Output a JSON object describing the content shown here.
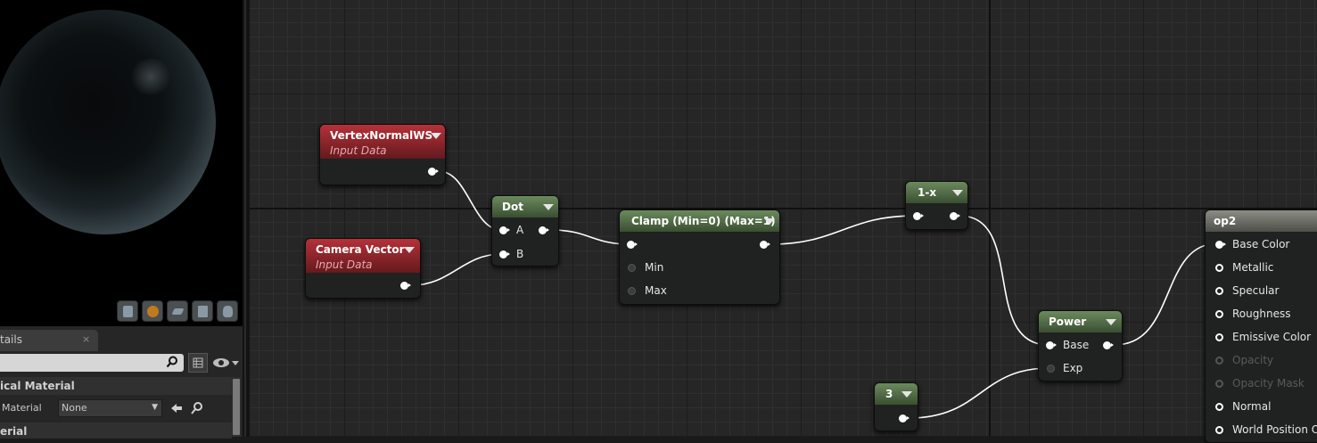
{
  "viewport": {
    "toolbar_buttons": [
      "cylinder-icon",
      "sphere-icon",
      "plane-icon",
      "cube-icon",
      "teapot-icon"
    ]
  },
  "details_panel": {
    "tab_label": "tails",
    "tab_close": "×",
    "search": {
      "value": "",
      "placeholder": ""
    },
    "section_title": "ical Material",
    "property": {
      "label": "Material",
      "value": "None"
    },
    "section2_title": "erial"
  },
  "graph": {
    "nodes": {
      "vertex_normal": {
        "title": "VertexNormalWS",
        "subtitle": "Input Data"
      },
      "camera_vector": {
        "title": "Camera Vector",
        "subtitle": "Input Data"
      },
      "dot": {
        "title": "Dot",
        "inputs": [
          "A",
          "B"
        ]
      },
      "clamp": {
        "title": "Clamp (Min=0) (Max=1)",
        "inputs": [
          "Min",
          "Max"
        ]
      },
      "one_minus": {
        "title": "1-x"
      },
      "power": {
        "title": "Power",
        "inputs": [
          "Base",
          "Exp"
        ]
      },
      "constant": {
        "title": "3"
      },
      "result": {
        "title": "op2",
        "inputs": [
          "Base Color",
          "Metallic",
          "Specular",
          "Roughness",
          "Emissive Color",
          "Opacity",
          "Opacity Mask",
          "Normal",
          "World Position Of"
        ]
      }
    }
  },
  "colors": {
    "input_node_header": "#b5313a",
    "function_node_header": "#6b8a5d",
    "result_node_header": "#8d8d86",
    "wire": "#ffffff",
    "graph_background": "#262626"
  }
}
